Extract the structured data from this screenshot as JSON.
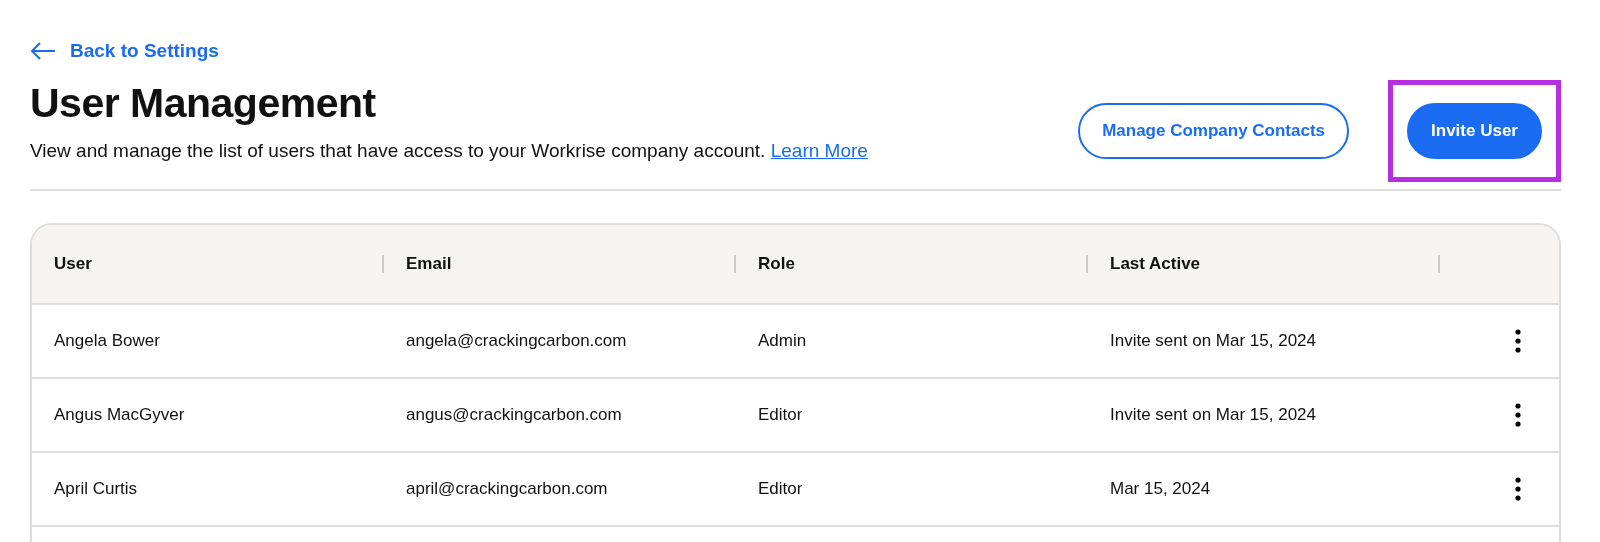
{
  "back_link": {
    "label": "Back to Settings"
  },
  "header": {
    "title": "User Management",
    "description": "View and manage the list of users that have access to your Workrise company account.",
    "learn_more": "Learn More"
  },
  "actions": [
    {
      "label": "Manage Company Contacts",
      "kind": "secondary",
      "highlighted": false
    },
    {
      "label": "Invite User",
      "kind": "primary",
      "highlighted": true
    }
  ],
  "table": {
    "columns": [
      "User",
      "Email",
      "Role",
      "Last Active"
    ],
    "rows": [
      {
        "user": "Angela Bower",
        "email": "angela@crackingcarbon.com",
        "role": "Admin",
        "last_active": "Invite sent on Mar 15, 2024"
      },
      {
        "user": "Angus MacGyver",
        "email": "angus@crackingcarbon.com",
        "role": "Editor",
        "last_active": "Invite sent on Mar 15, 2024"
      },
      {
        "user": "April Curtis",
        "email": "april@crackingcarbon.com",
        "role": "Editor",
        "last_active": "Mar 15, 2024"
      }
    ]
  }
}
